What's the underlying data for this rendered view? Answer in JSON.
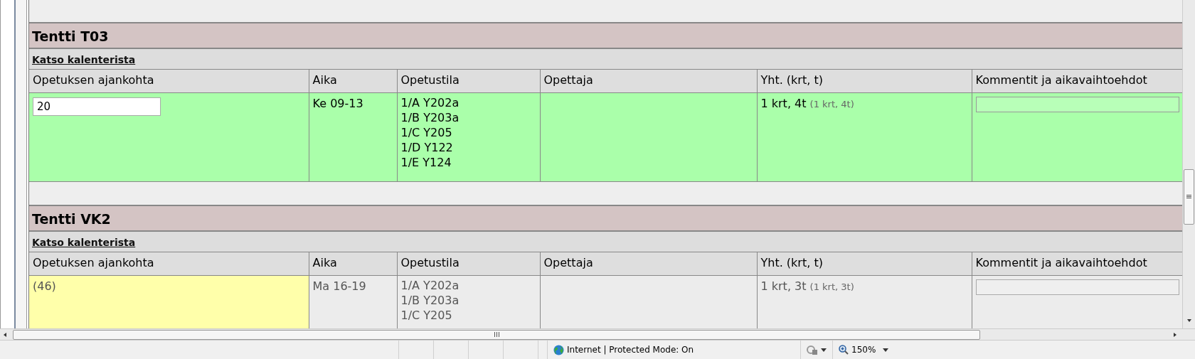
{
  "sections": [
    {
      "title": "Tentti T03",
      "link": "Katso kalenterista",
      "columns": [
        "Opetuksen ajankohta",
        "Aika",
        "Opetustila",
        "Opettaja",
        "Yht. (krt, t)",
        "Kommentit ja aikavaihtoehdot"
      ],
      "row": {
        "kind": "active",
        "period": "20",
        "time": "Ke 09-13",
        "rooms": [
          "1/A Y202a",
          "1/B Y203a",
          "1/C Y205",
          "1/D Y122",
          "1/E Y124"
        ],
        "total": "1 krt, 4t",
        "total_note": "(1 krt, 4t)"
      }
    },
    {
      "title": "Tentti VK2",
      "link": "Katso kalenterista",
      "columns": [
        "Opetuksen ajankohta",
        "Aika",
        "Opetustila",
        "Opettaja",
        "Yht. (krt, t)",
        "Kommentit ja aikavaihtoehdot"
      ],
      "row": {
        "kind": "inactive",
        "period": "(46)",
        "time": "Ma 16-19",
        "rooms": [
          "1/A Y202a",
          "1/B Y203a",
          "1/C Y205"
        ],
        "total": "1 krt, 3t",
        "total_note": "(1 krt, 3t)"
      }
    }
  ],
  "status_bar": {
    "zone": "Internet | Protected Mode: On",
    "zoom": "150%"
  }
}
